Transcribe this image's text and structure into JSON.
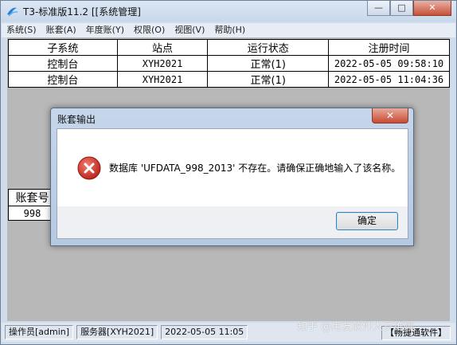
{
  "window": {
    "title": "T3-标准版11.2 [[系统管理]",
    "min_glyph": "—",
    "max_glyph": "□",
    "close_glyph": "✕"
  },
  "menu": [
    "系统(S)",
    "账套(A)",
    "年度账(Y)",
    "权限(O)",
    "视图(V)",
    "帮助(H)"
  ],
  "sessions_table": {
    "headers": [
      "子系统",
      "站点",
      "运行状态",
      "注册时间"
    ],
    "rows": [
      [
        "控制台",
        "XYH2021",
        "正常(1)",
        "2022-05-05 09:58:10"
      ],
      [
        "控制台",
        "XYH2021",
        "正常(1)",
        "2022-05-05 11:04:36"
      ]
    ]
  },
  "accounts_table": {
    "header": "账套号",
    "rows": [
      "998"
    ]
  },
  "status": {
    "operator": "操作员[admin]",
    "server": "服务器[XYH2021]",
    "datetime": "2022-05-05 11:05",
    "brand": "【畅捷通软件】"
  },
  "watermark": "知乎 @用友软件大罗维娜",
  "dialog": {
    "title": "账套输出",
    "message": "数据库 'UFDATA_998_2013' 不存在。请确保正确地输入了该名称。",
    "ok_label": "确定",
    "close_glyph": "✕"
  },
  "colors": {
    "error_red": "#d23a2e",
    "titlebar": "#c8d7ea",
    "content_gray": "#b8b8b8"
  },
  "icons": {
    "app": "app-logo-icon",
    "error": "error-icon"
  }
}
